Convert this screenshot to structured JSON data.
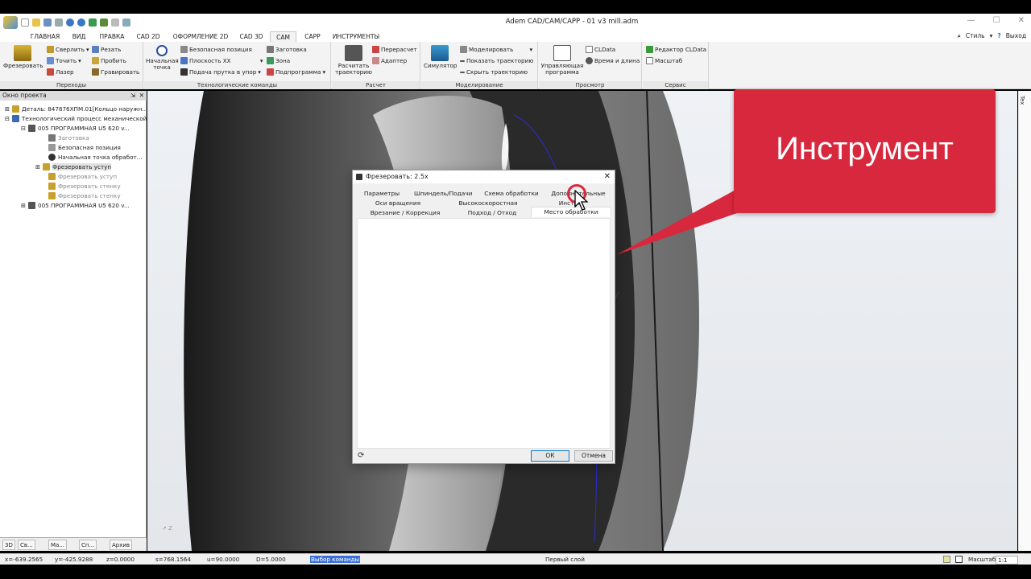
{
  "app": {
    "title": "Adem CAD/CAM/CAPP - 01 v3 mill.adm"
  },
  "menu": {
    "tabs": [
      "ГЛАВНАЯ",
      "ВИД",
      "ПРАВКА",
      "CAD 2D",
      "ОФОРМЛЕНИЕ 2D",
      "CAD 3D",
      "CAM",
      "CAPP",
      "ИНСТРУМЕНТЫ"
    ],
    "active": "CAM",
    "style_label": "Стиль",
    "exit_label": "Выход"
  },
  "ribbon": {
    "groups": [
      "Переходы",
      "Технологические команды",
      "Расчет",
      "Моделирование",
      "Просмотр",
      "Сервис"
    ],
    "perehody": {
      "big": "Фрезеровать",
      "items": [
        "Сверлить",
        "Резать",
        "Точить",
        "Пробить",
        "Лазер",
        "Гравировать"
      ]
    },
    "tech": {
      "big1": "Начальная",
      "big2": "точка",
      "items": [
        "Безопасная позиция",
        "Заготовка",
        "Плоскость XX",
        "Зона",
        "Подача прутка в упор",
        "Подпрограмма"
      ]
    },
    "raschet": {
      "big1": "Расчитать",
      "big2": "траекторию",
      "items": [
        "Перерасчет",
        "Адаптер"
      ]
    },
    "model": {
      "big": "Симулятор",
      "items": [
        "Моделировать",
        "Показать траекторию",
        "Скрыть траекторию"
      ]
    },
    "prosmotr": {
      "big1": "Управляющая",
      "big2": "программа",
      "items": [
        "CLData",
        "Время и длина"
      ]
    },
    "servis": {
      "items": [
        "Редактор CLData",
        "Масштаб"
      ]
    }
  },
  "panel": {
    "title": "Окно проекта",
    "tree": [
      "Деталь: 847876ХПМ.01[Кольцо наружн...",
      "Технологический процесс механической",
      "005  ПРОГРАММНАЯ U5 620 v...",
      "Заготовка",
      "Безопасная позиция",
      "Начальная точка обработ...",
      "Фрезеровать уступ",
      "Фрезеровать уступ",
      "Фрезеровать стенку",
      "Фрезеровать стенку",
      "005  ПРОГРАММНАЯ U5 620 v..."
    ],
    "bottom_tabs": [
      "3D",
      "Св...",
      "Ма...",
      "Сп...",
      "Архив"
    ]
  },
  "dialog": {
    "title": "Фрезеровать: 2.5x",
    "tabs_row1": [
      "Параметры",
      "Шпиндель/Подачи",
      "Схема обработки",
      "Дополнительные"
    ],
    "tabs_row2": [
      "Оси вращения",
      "Высокоскоростная",
      "Инстр..."
    ],
    "tabs_row3": [
      "Врезание / Коррекция",
      "Подход / Отход",
      "Место обработки"
    ],
    "ok": "ОК",
    "cancel": "Отмена"
  },
  "callout": {
    "text": "Инструмент",
    "color": "#d8283d"
  },
  "status": {
    "x": "x=-639.2565",
    "y": "y=-425.9288",
    "z": "z=0.0000",
    "s": "s=768.1564",
    "u": "u=90.0000",
    "d": "D=5.0000",
    "cmd": "Выбор команды",
    "layer": "Первый слой",
    "scale_label": "Масштаб",
    "scale_value": "1:1"
  },
  "viewport": {
    "side_label": "Tex"
  }
}
